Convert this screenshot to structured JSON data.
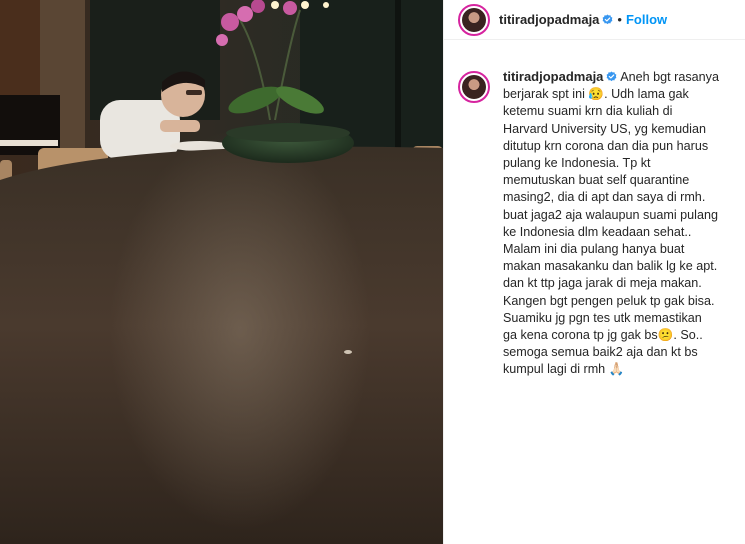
{
  "post": {
    "username": "titiradjopadmaja",
    "separator": "•",
    "follow_label": "Follow",
    "verified": true,
    "caption": "Aneh bgt rasanya\nberjarak spt ini 😥. Udh lama gak\nketemu suami krn dia kuliah di\nHarvard University US, yg kemudian\nditutup krn corona dan dia pun harus\npulang ke Indonesia. Tp kt\nmemutuskan buat self quarantine\nmasing2, dia di apt dan saya di rmh.\nbuat jaga2 aja walaupun suami pulang\nke Indonesia dlm keadaan sehat..\nMalam ini dia pulang hanya buat\nmakan masakanku dan balik lg ke apt.\ndan kt ttp jaga jarak di meja makan.\nKangen bgt pengen peluk tp gak bisa.\nSuamiku jg pgn tes utk memastikan\nga kena corona tp jg gak bs😕. So..\nsemoga semua baik2 aja dan kt bs\nkumpul lagi di rmh 🙏🏻"
  },
  "colors": {
    "link_blue": "#0095f6",
    "verified_blue": "#3897f0",
    "avatar_ring": "#d6249f"
  },
  "icons": {
    "verified": "verified-badge-icon",
    "avatar": "profile-avatar"
  }
}
